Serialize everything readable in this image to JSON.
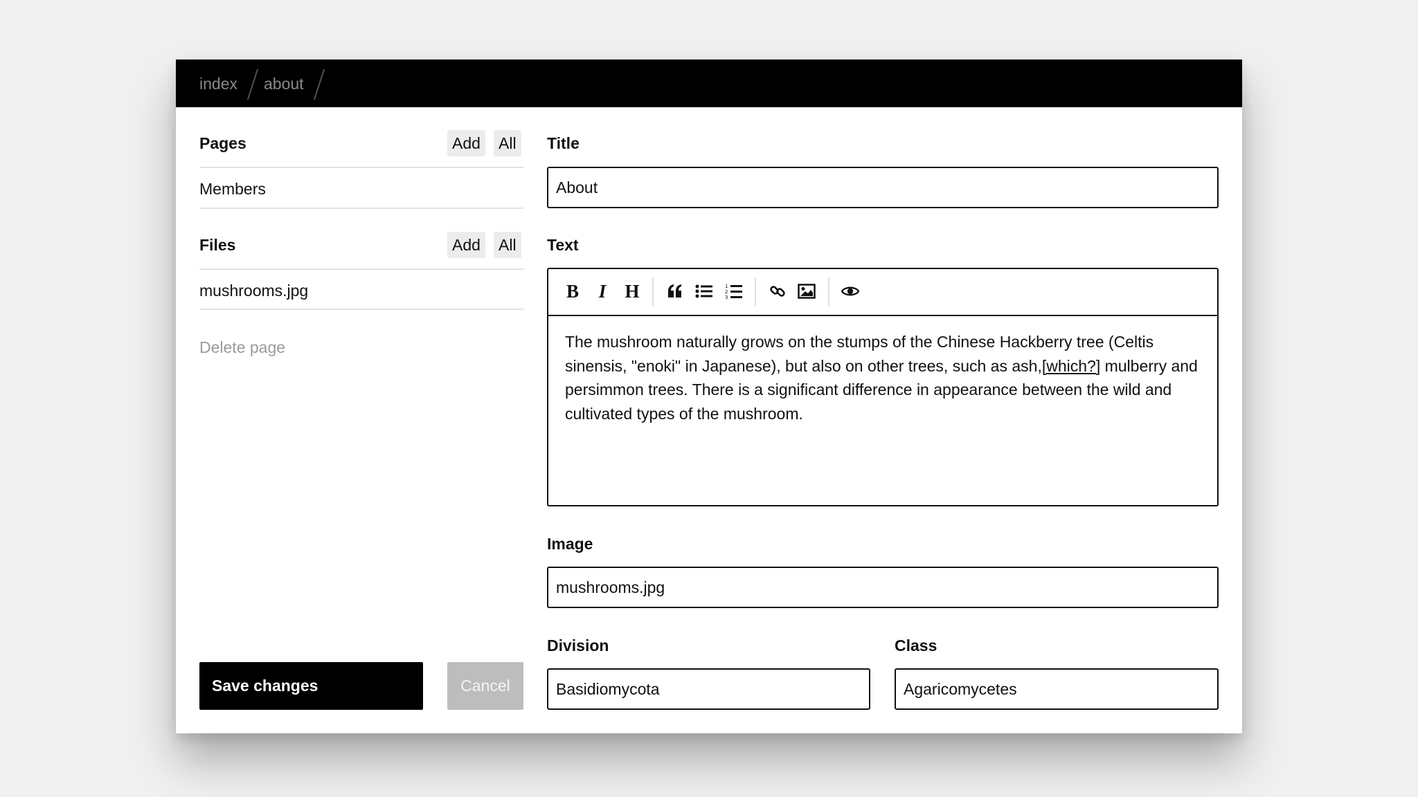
{
  "breadcrumb": [
    {
      "label": "index"
    },
    {
      "label": "about"
    }
  ],
  "sidebar": {
    "pages": {
      "heading": "Pages",
      "add_label": "Add",
      "all_label": "All",
      "items": [
        "Members"
      ]
    },
    "files": {
      "heading": "Files",
      "add_label": "Add",
      "all_label": "All",
      "items": [
        "mushrooms.jpg"
      ]
    },
    "delete_label": "Delete page",
    "save_label": "Save changes",
    "cancel_label": "Cancel"
  },
  "form": {
    "title_label": "Title",
    "title_value": "About",
    "text_label": "Text",
    "text_before_ref": "The mushroom naturally grows on the stumps of the Chinese Hackberry tree (Celtis sinensis, \"enoki\" in Japanese), but also on other trees, such as ash,",
    "text_ref": "[which?]",
    "text_after_ref": " mulberry and persimmon trees. There is a significant difference in appearance between the wild and cultivated types of the mushroom.",
    "toolbar_icons": [
      "bold-icon",
      "italic-icon",
      "heading-icon",
      "quote-icon",
      "bulleted-list-icon",
      "numbered-list-icon",
      "link-icon",
      "image-icon",
      "preview-eye-icon"
    ],
    "toolbar_glyphs": {
      "bold": "B",
      "italic": "I",
      "heading": "H"
    },
    "image_label": "Image",
    "image_value": "mushrooms.jpg",
    "division_label": "Division",
    "division_value": "Basidiomycota",
    "class_label": "Class",
    "class_value": "Agaricomycetes"
  }
}
